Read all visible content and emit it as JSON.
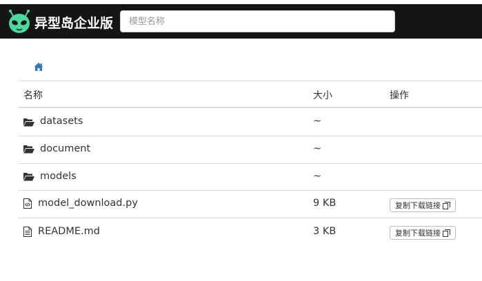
{
  "header": {
    "brand_name": "异型岛企业版",
    "logo_icon": "alien-head-icon",
    "search_placeholder": "模型名称"
  },
  "breadcrumb": {
    "icon": "home-icon"
  },
  "table": {
    "columns": {
      "name": "名称",
      "size": "大小",
      "actions": "操作"
    },
    "rows": [
      {
        "type": "folder",
        "name": "datasets",
        "size": "~",
        "action": ""
      },
      {
        "type": "folder",
        "name": "document",
        "size": "~",
        "action": ""
      },
      {
        "type": "folder",
        "name": "models",
        "size": "~",
        "action": ""
      },
      {
        "type": "code-file",
        "name": "model_download.py",
        "size": "9 KB",
        "action": "复制下载链接"
      },
      {
        "type": "text-file",
        "name": "README.md",
        "size": "3 KB",
        "action": "复制下载链接"
      }
    ]
  },
  "colors": {
    "topbar": "#151515",
    "logo": "#4cd9a0",
    "link": "#337ab7"
  }
}
